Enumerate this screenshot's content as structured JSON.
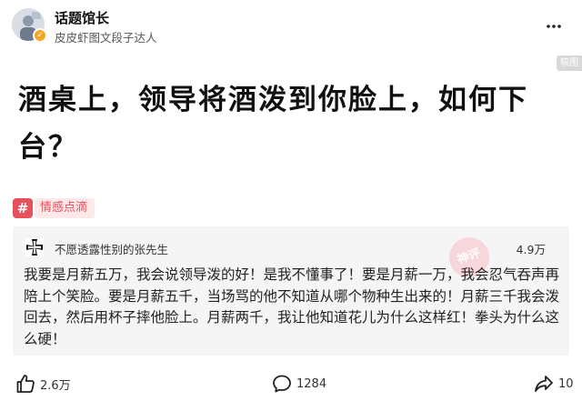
{
  "author": {
    "name": "话题馆长",
    "description": "皮皮虾图文段子达人"
  },
  "badge": {
    "label": "稿图"
  },
  "post": {
    "title": "酒桌上，领导将酒泼到你脸上，如何下台？"
  },
  "topic": {
    "hash_symbol": "#",
    "label": "情感点滴"
  },
  "comment": {
    "username": "不愿透露性别的张先生",
    "likes": "4.9万",
    "stamp_text": "神评",
    "text": "我要是月薪五万，我会说领导泼的好！是我不懂事了！要是月薪一万，我会忍气吞声再陪上个笑脸。要是月薪五千，当场骂的他不知道从哪个物种生出来的！月薪三千我会泼回去，然后用杯子摔他脸上。月薪两千，我让他知道花儿为什么这样红！拳头为什么这么硬！"
  },
  "actions": {
    "like_count": "2.6万",
    "comment_count": "1284",
    "share_count": "10"
  },
  "icons": {
    "avatar": "avatar-image",
    "verified": "verified-badge-icon",
    "more": "more-icon",
    "comment_avatar": "iron-cross-avatar-icon",
    "like": "thumbs-up-icon",
    "comment": "comment-bubble-icon",
    "share": "share-arrow-icon"
  },
  "colors": {
    "topic_accent": "#e8505b",
    "verified": "#f5a623",
    "card_bg": "#f5f5f6"
  }
}
